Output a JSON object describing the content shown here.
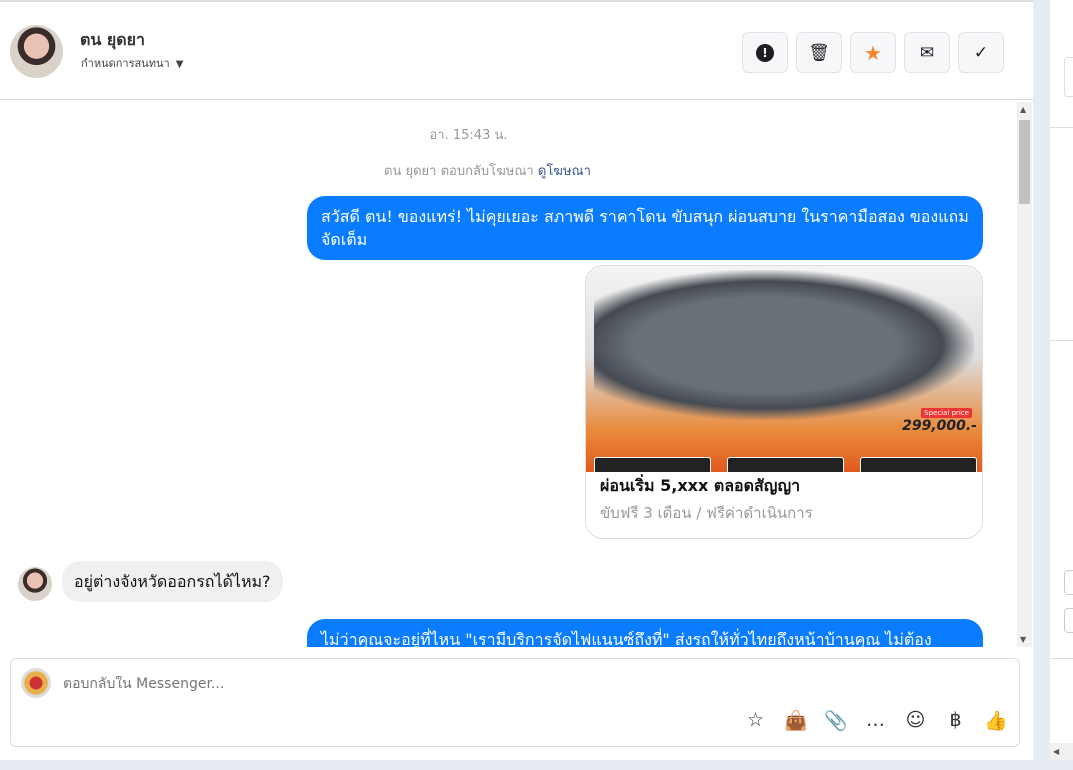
{
  "header": {
    "name": "ตน ยุดยา",
    "subtitle": "กำหนดการสนทนา"
  },
  "actions": [
    {
      "name": "report",
      "icon": "!"
    },
    {
      "name": "delete",
      "icon": "🗑"
    },
    {
      "name": "star",
      "icon": "★"
    },
    {
      "name": "mark-unread",
      "icon": "✉"
    },
    {
      "name": "done",
      "icon": "✓"
    }
  ],
  "messages": {
    "timestamp": "อา. 15:43 น.",
    "replied_text": "ตน ยุดยา ตอบกลับโฆษณา",
    "view_ad": "ดูโฆษณา",
    "m1": "สวัสดี ตน! ของแทร่! ไม่คุยเยอะ สภาพดี ราคาโดน ขับสนุก ผ่อนสบาย ในราคามือสอง ของแถมจัดเต็ม",
    "card": {
      "special": "Special price",
      "price": "299,000.-",
      "title": "ผ่อนเริ่ม 5,xxx ตลอดสัญญา",
      "subtitle": "ขับฟรี 3 เดือน / ฟรีค่าดำเนินการ"
    },
    "m2": "อยู่ต่างจังหวัดออกรถได้ไหม?",
    "m3": "ไม่ว่าคุณจะอยู่ที่ไหน \"เรามีบริการจัดไฟแนนซ์ถึงที่\" ส่งรถให้ทั่วไทยถึงหน้าบ้านคุณ ไม่ต้อง"
  },
  "composer": {
    "placeholder": "ตอบกลับใน Messenger...",
    "tools": [
      "☆",
      "👜",
      "📎",
      "…",
      "☺",
      "฿",
      "👍"
    ]
  },
  "accent": "#0a7cff"
}
